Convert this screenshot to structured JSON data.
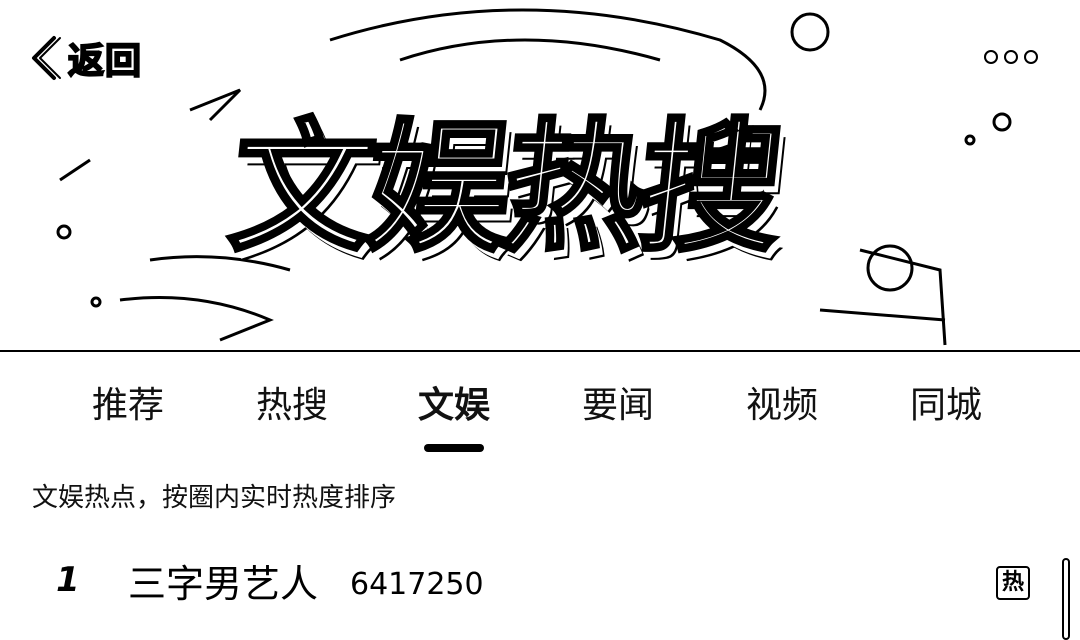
{
  "header": {
    "back_label": "返回",
    "banner_title": "文娱热搜"
  },
  "tabs": [
    {
      "label": "推荐"
    },
    {
      "label": "热搜"
    },
    {
      "label": "文娱",
      "active": true
    },
    {
      "label": "要闻"
    },
    {
      "label": "视频"
    },
    {
      "label": "同城"
    }
  ],
  "description": "文娱热点，按圈内实时热度排序",
  "list": [
    {
      "rank": "1",
      "title": "三字男艺人",
      "heat": "6417250",
      "badge": "热"
    }
  ]
}
